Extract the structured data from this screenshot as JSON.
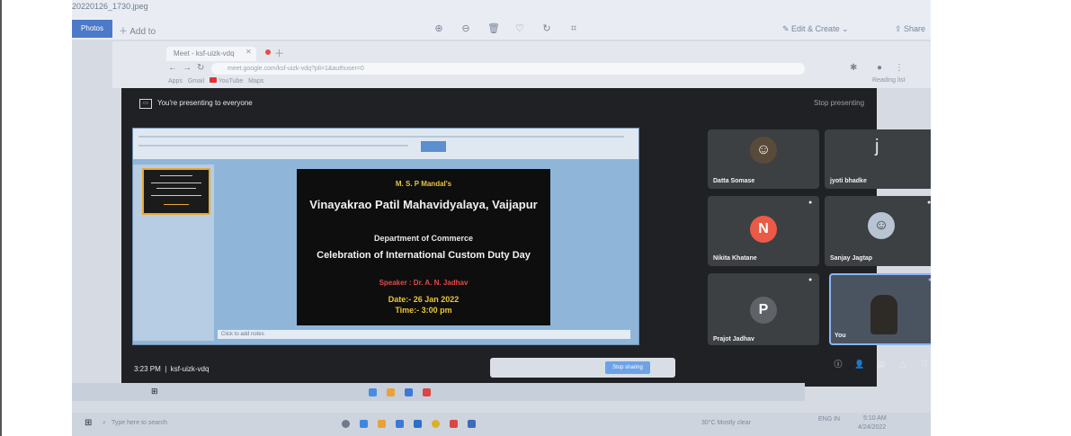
{
  "photos_app": {
    "title": "20220126_1730.jpeg",
    "primary_button": "Photos",
    "add_to": "Add to",
    "edit_create": "Edit & Create",
    "share": "Share"
  },
  "browser": {
    "tab_title": "Meet - ksf-uizk-vdq",
    "url": "meet.google.com/ksf-uizk-vdq?pli=1&authuser=0",
    "bookmarks": [
      "Apps",
      "Gmail",
      "YouTube",
      "Maps"
    ],
    "reading_list": "Reading list"
  },
  "meet": {
    "presenting_banner": "You're presenting to everyone",
    "stop_presenting": "Stop presenting",
    "clock": "3:23 PM",
    "meeting_code": "ksf-uizk-vdq",
    "share_bar_button": "Stop sharing",
    "participants": [
      {
        "name": "Datta Somase",
        "initial": ""
      },
      {
        "name": "jyoti bhadke",
        "initial": "j"
      },
      {
        "name": "Nikita Khatane",
        "initial": "N"
      },
      {
        "name": "Sanjay Jagtap",
        "initial": ""
      },
      {
        "name": "Prajot Jadhav",
        "initial": "P"
      },
      {
        "name": "You",
        "initial": ""
      }
    ]
  },
  "slide": {
    "org": "M. S. P Mandal's",
    "college": "Vinayakrao Patil Mahavidyalaya, Vaijapur",
    "department": "Department of Commerce",
    "event": "Celebration of International Custom Duty Day",
    "speaker": "Speaker : Dr. A. N. Jadhav",
    "date": "Date:- 26 Jan 2022",
    "time": "Time:- 3:00 pm",
    "notes_placeholder": "Click to add notes"
  },
  "taskbar": {
    "search_placeholder": "Type here to search",
    "weather": "30°C Mostly clear",
    "time": "5:10 AM",
    "date": "4/24/2022",
    "language": "ENG IN"
  },
  "colors": {
    "meet_bg": "#202124",
    "tile_bg": "#3c4043",
    "avatar_nikita": "#ea5a47",
    "avatar_prajot": "#5f6368",
    "slide_accent": "#ecc833",
    "speaker_red": "#e14b4b",
    "active_speaker": "#8ab4f8"
  }
}
